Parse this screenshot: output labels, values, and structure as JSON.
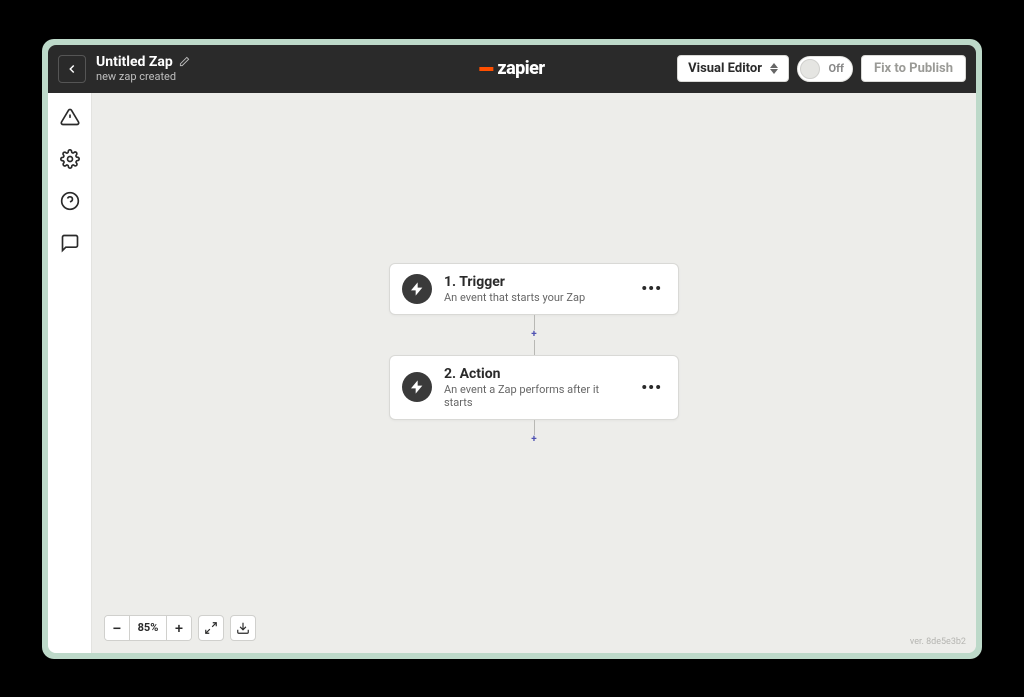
{
  "header": {
    "title": "Untitled Zap",
    "subtitle": "new zap created",
    "logo_text": "zapier",
    "visual_editor_label": "Visual Editor",
    "toggle_label": "Off",
    "publish_label": "Fix to Publish"
  },
  "steps": [
    {
      "title": "1. Trigger",
      "desc": "An event that starts your Zap"
    },
    {
      "title": "2. Action",
      "desc": "An event a Zap performs after it starts"
    }
  ],
  "zoom": {
    "level": "85%"
  },
  "footer": {
    "version": "ver. 8de5e3b2"
  }
}
